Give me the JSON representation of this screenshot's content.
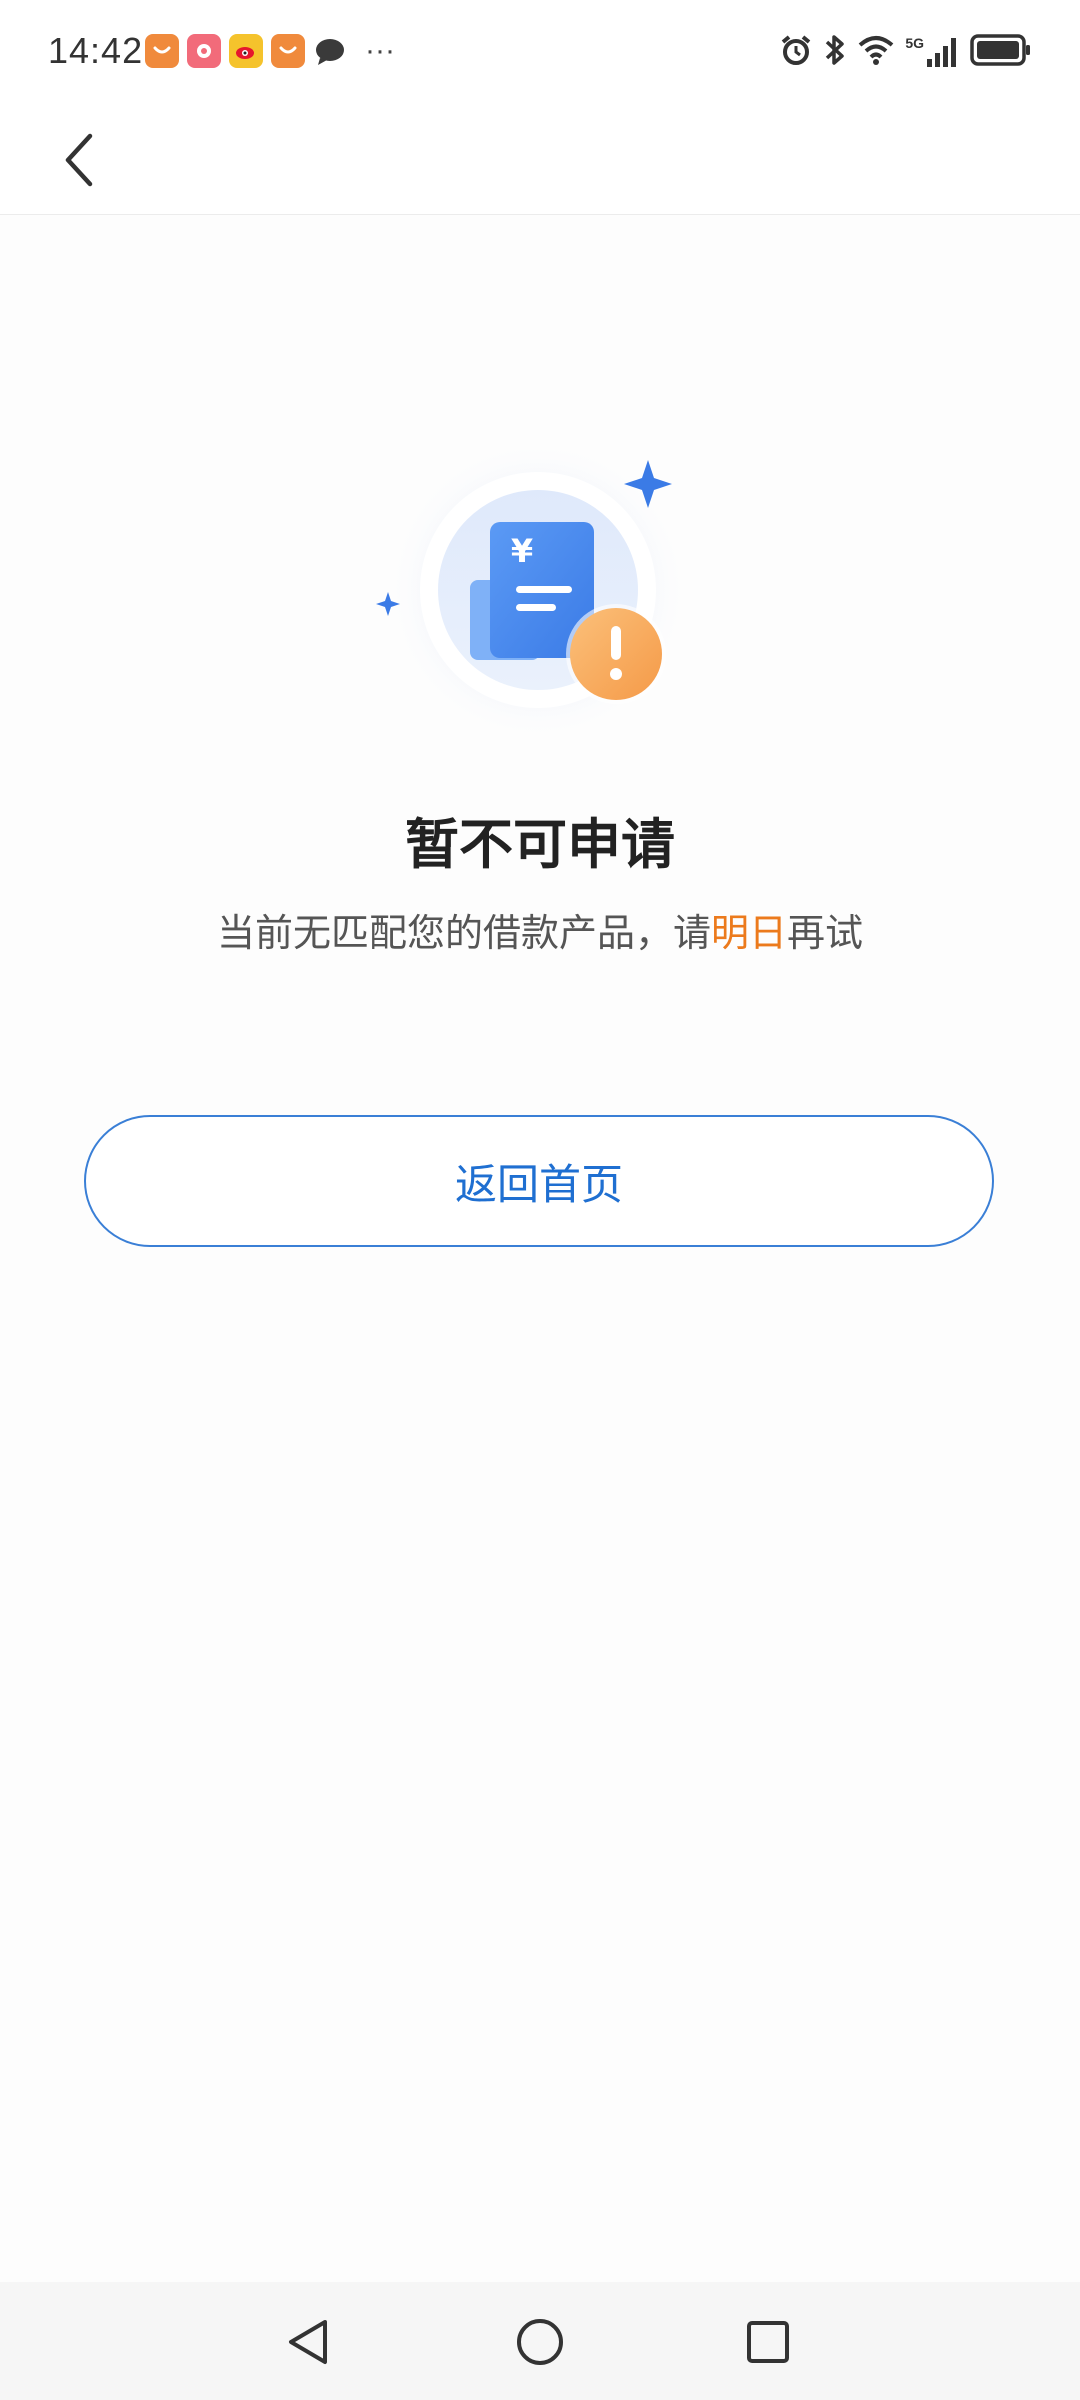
{
  "status_bar": {
    "time": "14:42",
    "notification_icons": [
      "taobao-icon",
      "app-icon",
      "weibo-icon",
      "taobao-icon",
      "message-icon"
    ],
    "more": "···",
    "system_icons": [
      "alarm-icon",
      "bluetooth-icon",
      "wifi-icon",
      "5g-signal-icon",
      "battery-icon"
    ],
    "network_label": "5G"
  },
  "header": {
    "back_icon": "chevron-left-icon"
  },
  "main": {
    "title": "暂不可申请",
    "subtitle_prefix": "当前无匹配您的借款产品，请",
    "subtitle_highlight": "明日",
    "subtitle_suffix": "再试",
    "illustration_symbol": "¥",
    "home_button_label": "返回首页"
  },
  "colors": {
    "accent_blue": "#1f6fd1",
    "highlight_orange": "#ec7a1c",
    "warning_orange": "#f7a65c"
  },
  "nav_bar": {
    "items": [
      "back-triangle-icon",
      "home-circle-icon",
      "recents-square-icon"
    ]
  }
}
